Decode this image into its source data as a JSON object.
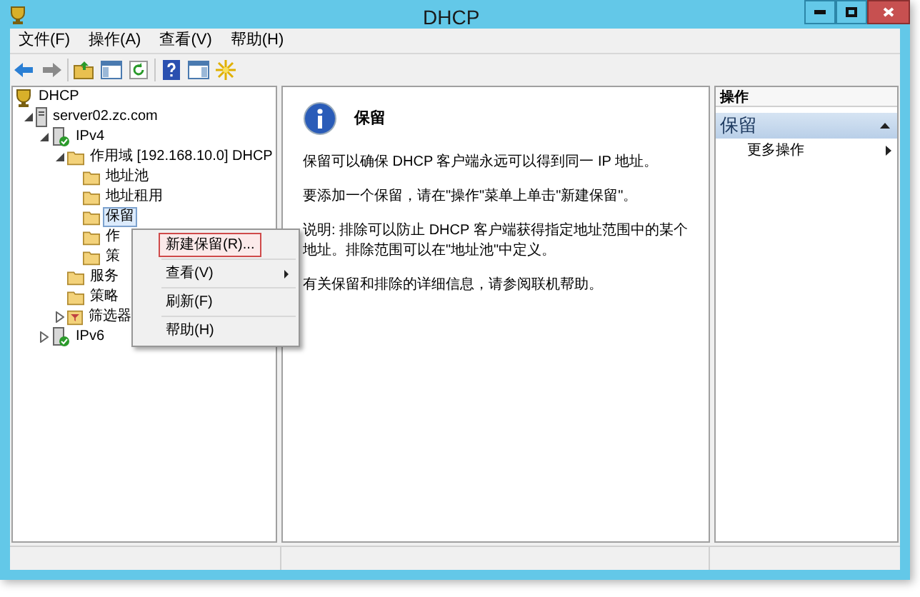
{
  "window": {
    "title": "DHCP"
  },
  "menu_bar": [
    "文件(F)",
    "操作(A)",
    "查看(V)",
    "帮助(H)"
  ],
  "tree": [
    {
      "label": "DHCP",
      "kind": "dhcp",
      "selected": false,
      "children": [
        {
          "label": "server02.zc.com",
          "kind": "server",
          "selected": false,
          "expanded": true,
          "children": [
            {
              "label": "IPv4",
              "kind": "protocol",
              "selected": false,
              "expanded": true,
              "children": [
                {
                  "label": "作用域 [192.168.10.0] DHCP",
                  "kind": "folder",
                  "selected": false,
                  "expanded": true,
                  "children": [
                    {
                      "label": "地址池",
                      "kind": "folder",
                      "selected": false
                    },
                    {
                      "label": "地址租用",
                      "kind": "folder",
                      "selected": false
                    },
                    {
                      "label": "保留",
                      "kind": "folder",
                      "selected": true
                    },
                    {
                      "label": "作",
                      "kind": "folder",
                      "selected": false
                    },
                    {
                      "label": "策",
                      "kind": "folder",
                      "selected": false
                    }
                  ]
                },
                {
                  "label": "服务",
                  "kind": "folder",
                  "selected": false
                },
                {
                  "label": "策略",
                  "kind": "folder",
                  "selected": false
                },
                {
                  "label": "筛选器",
                  "kind": "filter",
                  "selected": false,
                  "expanded": false
                }
              ]
            },
            {
              "label": "IPv6",
              "kind": "protocol",
              "selected": false,
              "expanded": false
            }
          ]
        }
      ]
    }
  ],
  "context_menu": [
    {
      "label": "新建保留(R)...",
      "selected": true,
      "submenu": false
    },
    {
      "label": "查看(V)",
      "selected": false,
      "submenu": true
    },
    {
      "label": "刷新(F)",
      "selected": false,
      "submenu": false
    },
    {
      "label": "帮助(H)",
      "selected": false,
      "submenu": false
    }
  ],
  "content": {
    "title": "保留",
    "paragraphs": [
      "保留可以确保 DHCP 客户端永远可以得到同一 IP 地址。",
      "要添加一个保留，请在\"操作\"菜单上单击\"新建保留\"。",
      "说明: 排除可以防止 DHCP 客户端获得指定地址范围中的某个地址。排除范围可以在\"地址池\"中定义。",
      "有关保留和排除的详细信息，请参阅联机帮助。"
    ]
  },
  "actions": {
    "header": "操作",
    "section": {
      "title": "保留",
      "expanded": true
    },
    "items": [
      {
        "label": "更多操作",
        "submenu": true
      }
    ]
  }
}
